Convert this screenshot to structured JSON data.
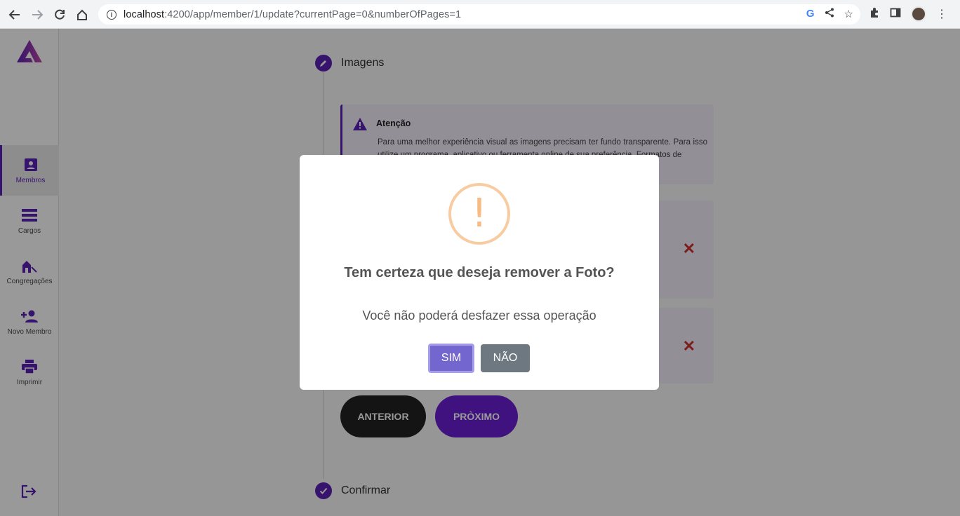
{
  "browser": {
    "url_host": "localhost",
    "url_rest": ":4200/app/member/1/update?currentPage=0&numberOfPages=1"
  },
  "sidebar": {
    "items": [
      {
        "label": "Membros",
        "icon": "person-card-icon"
      },
      {
        "label": "Cargos",
        "icon": "list-icon"
      },
      {
        "label": "Congregações",
        "icon": "church-icon"
      },
      {
        "label": "Novo Membro",
        "icon": "person-add-icon"
      },
      {
        "label": "Imprimir",
        "icon": "printer-icon"
      }
    ]
  },
  "stepper": {
    "step_images_title": "Imagens",
    "step_confirm_title": "Confirmar"
  },
  "alert": {
    "title": "Atenção",
    "text": "Para uma melhor experiência visual as imagens precisam ter fundo transparente. Para isso utilize um programa, aplicativo ou ferramenta online de sua preferência. Formatos de"
  },
  "buttons": {
    "previous": "ANTERIOR",
    "next": "PRÒXIMO"
  },
  "dialog": {
    "icon_glyph": "!",
    "title": "Tem certeza que deseja remover a Foto?",
    "text": "Você não poderá desfazer essa operação",
    "confirm": "SIM",
    "cancel": "NÃO"
  },
  "colors": {
    "brand": "#5b21b6",
    "warning": "#f8bb86",
    "confirm": "#7367cf",
    "cancel": "#6e7881",
    "danger": "#d32f2f"
  }
}
